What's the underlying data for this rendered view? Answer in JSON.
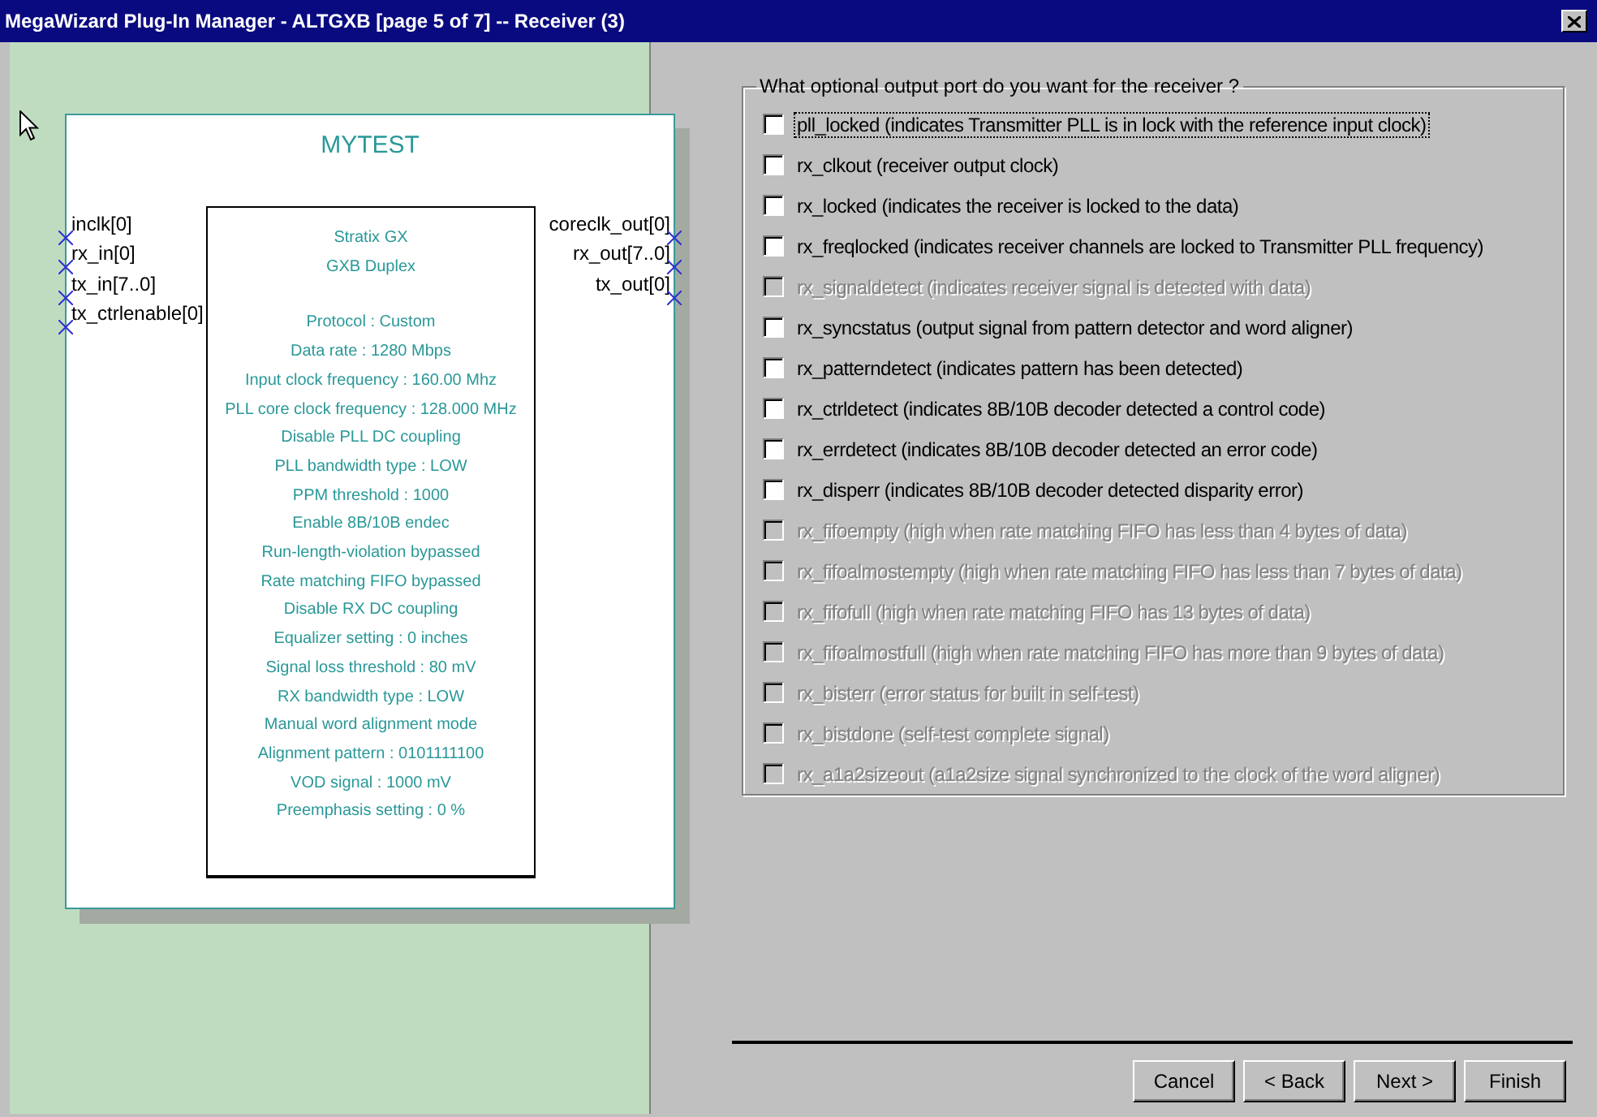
{
  "window": {
    "title": "MegaWizard Plug-In Manager - ALTGXB [page 5 of 7] -- Receiver (3)"
  },
  "symbol": {
    "name": "MYTEST",
    "device_lines": [
      "Stratix GX",
      "GXB Duplex"
    ],
    "settings": [
      "Protocol : Custom",
      "Data rate : 1280 Mbps",
      "Input clock frequency : 160.00 Mhz",
      "PLL core clock frequency : 128.000 MHz",
      "Disable PLL DC coupling",
      "PLL bandwidth type : LOW",
      "PPM threshold : 1000",
      "Enable 8B/10B endec",
      "Run-length-violation bypassed",
      "Rate matching FIFO bypassed",
      "Disable RX DC coupling",
      "Equalizer setting : 0 inches",
      "Signal loss threshold : 80 mV",
      "RX bandwidth type : LOW",
      "Manual word alignment mode",
      "Alignment pattern : 0101111100",
      "VOD signal : 1000 mV",
      "Preemphasis setting : 0 %"
    ],
    "inputs": [
      "inclk[0]",
      "rx_in[0]",
      "tx_in[7..0]",
      "tx_ctrlenable[0]"
    ],
    "outputs": [
      "coreclk_out[0]",
      "rx_out[7..0]",
      "tx_out[0]"
    ]
  },
  "options": {
    "legend": "What optional output port do you want for the receiver ?",
    "items": [
      {
        "label": "pll_locked (indicates Transmitter PLL is in lock with the reference input clock)",
        "checked": false,
        "disabled": false,
        "focused": true
      },
      {
        "label": "rx_clkout (receiver output clock)",
        "checked": false,
        "disabled": false,
        "focused": false
      },
      {
        "label": "rx_locked (indicates the receiver is locked to the data)",
        "checked": false,
        "disabled": false,
        "focused": false
      },
      {
        "label": "rx_freqlocked (indicates receiver channels are locked to Transmitter PLL frequency)",
        "checked": false,
        "disabled": false,
        "focused": false
      },
      {
        "label": "rx_signaldetect (indicates receiver signal is detected with data)",
        "checked": false,
        "disabled": true,
        "focused": false
      },
      {
        "label": "rx_syncstatus (output signal from pattern detector and word aligner)",
        "checked": false,
        "disabled": false,
        "focused": false
      },
      {
        "label": "rx_patterndetect (indicates pattern has been detected)",
        "checked": false,
        "disabled": false,
        "focused": false
      },
      {
        "label": "rx_ctrldetect (indicates 8B/10B decoder detected a control code)",
        "checked": false,
        "disabled": false,
        "focused": false
      },
      {
        "label": "rx_errdetect (indicates 8B/10B decoder detected an error code)",
        "checked": false,
        "disabled": false,
        "focused": false
      },
      {
        "label": "rx_disperr (indicates 8B/10B decoder detected disparity error)",
        "checked": false,
        "disabled": false,
        "focused": false
      },
      {
        "label": "rx_fifoempty (high when rate matching FIFO has less than 4 bytes of data)",
        "checked": false,
        "disabled": true,
        "focused": false
      },
      {
        "label": "rx_fifoalmostempty (high when rate matching FIFO has less than 7 bytes of data)",
        "checked": false,
        "disabled": true,
        "focused": false
      },
      {
        "label": "rx_fifofull (high when rate matching FIFO has 13 bytes of data)",
        "checked": false,
        "disabled": true,
        "focused": false
      },
      {
        "label": "rx_fifoalmostfull (high when rate matching FIFO  has more than 9 bytes of data)",
        "checked": false,
        "disabled": true,
        "focused": false
      },
      {
        "label": "rx_bisterr (error status for built in self-test)",
        "checked": false,
        "disabled": true,
        "focused": false
      },
      {
        "label": "rx_bistdone (self-test complete signal)",
        "checked": false,
        "disabled": true,
        "focused": false
      },
      {
        "label": "rx_a1a2sizeout (a1a2size signal synchronized to the clock of the word aligner)",
        "checked": false,
        "disabled": true,
        "focused": false
      }
    ]
  },
  "buttons": [
    {
      "label": "Cancel"
    },
    {
      "label": "< Back"
    },
    {
      "label": "Next >"
    },
    {
      "label": "Finish"
    }
  ]
}
